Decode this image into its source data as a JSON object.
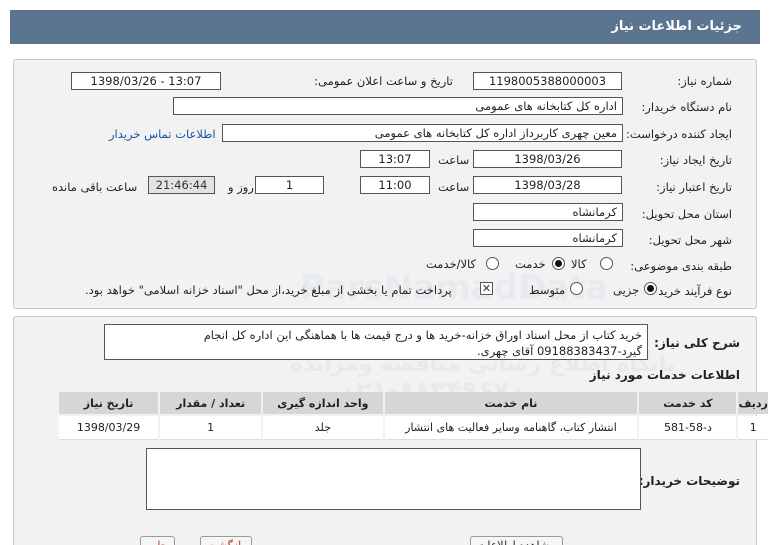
{
  "header": {
    "title": "جزئیات اطلاعات نیاز"
  },
  "form": {
    "need_number": {
      "label": "شماره نیاز:",
      "value": "1198005388000003"
    },
    "announce": {
      "label": "تاریخ و ساعت اعلان عمومی:",
      "value": "1398/03/26 - 13:07"
    },
    "buyer_org": {
      "label": "نام دستگاه خریدار:",
      "value": "اداره کل کتابخانه های عمومی"
    },
    "requester": {
      "label": "ایجاد کننده درخواست:",
      "value": "معین چهری کاربرداز اداره کل کتابخانه های عمومی",
      "contact_link": "اطلاعات تماس خریدار"
    },
    "created": {
      "label": "تاریخ ایجاد نیاز:",
      "date": "1398/03/26",
      "time_label": "ساعت",
      "time": "13:07"
    },
    "validity": {
      "label": "تاریخ اعتبار نیاز:",
      "date": "1398/03/28",
      "time_label": "ساعت",
      "time": "11:00",
      "days": "1",
      "days_label": "روز و",
      "remaining": "21:46:44",
      "remaining_label": "ساعت باقی مانده"
    },
    "province": {
      "label": "استان محل تحویل:",
      "value": "کرمانشاه"
    },
    "city": {
      "label": "شهر محل تحویل:",
      "value": "کرمانشاه"
    },
    "category": {
      "label": "طبقه بندی موضوعی:",
      "options": [
        "کالا",
        "خدمت",
        "کالا/خدمت"
      ],
      "selected": "خدمت"
    },
    "process": {
      "label": "نوع فرآیند خرید :",
      "options": [
        "جزیی",
        "متوسط"
      ],
      "selected": "جزیی",
      "payment_note": "پرداخت تمام یا بخشی از مبلغ خرید،از محل \"اسناد خزانه اسلامی\" خواهد بود."
    }
  },
  "details": {
    "summary_label": "شرح کلی نیاز:",
    "summary_text": "خرید کتاب از محل اسناد اوراق خزانه-خرید ها و درج قیمت ها با هماهنگی این اداره کل انجام گیرد-09188383437 آقای چهری.",
    "services_title": "اطلاعات خدمات مورد نیاز",
    "table": {
      "headers": [
        "ردیف",
        "کد خدمت",
        "نام خدمت",
        "واحد اندازه گیری",
        "تعداد / مقدار",
        "تاریخ نیاز"
      ],
      "rows": [
        [
          "1",
          "د-58-581",
          "انتشار کتاب، گاهنامه وسایر فعالیت های انتشار",
          "جلد",
          "1",
          "1398/03/29"
        ]
      ]
    },
    "buyer_notes_label": "توضیحات خریدار:"
  },
  "watermark": {
    "line1": "ParsNamadData",
    "line2": "پایگاه اطلاع رسانی مناقصه ومزایده",
    "line3": "۰۲۱-۸۸۳۴۹۶۷۰"
  },
  "bottom_buttons": [
    "مشاهده اطلاعات",
    "بازگشت",
    "چاپ"
  ]
}
